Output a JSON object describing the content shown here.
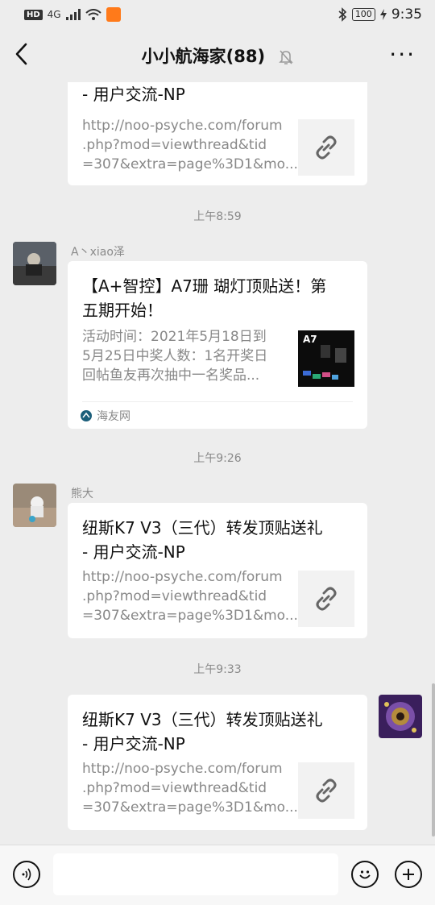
{
  "status_bar": {
    "left_badge": "HD",
    "network": "4G",
    "battery": "100",
    "time": "9:35"
  },
  "header": {
    "title": "小小航海家(88)",
    "more_label": "···"
  },
  "messages": [
    {
      "card_title": "- 用户交流-NP",
      "card_desc_1": "http://noo-psyche.com/forum",
      "card_desc_2": ".php?mod=viewthread&tid",
      "card_desc_3": "=307&extra=page%3D1&mo..."
    },
    {
      "time": "上午8:59",
      "sender": "A丶xiao泽",
      "card_title_1": "【A+智控】A7珊 瑚灯顶贴送！第",
      "card_title_2": "五期开始！",
      "card_desc_1": "活动时间：2021年5月18日到",
      "card_desc_2": "5月25日中奖人数：1名开奖日",
      "card_desc_3": "回帖鱼友再次抽中一名奖品...",
      "thumb_text": "A7",
      "source": "海友网"
    },
    {
      "time": "上午9:26",
      "sender": "熊大",
      "card_title_1": "纽斯K7 V3（三代）转发顶贴送礼",
      "card_title_2": "- 用户交流-NP",
      "card_desc_1": "http://noo-psyche.com/forum",
      "card_desc_2": ".php?mod=viewthread&tid",
      "card_desc_3": "=307&extra=page%3D1&mo..."
    },
    {
      "time": "上午9:33",
      "card_title_1": "纽斯K7 V3（三代）转发顶贴送礼",
      "card_title_2": "- 用户交流-NP",
      "card_desc_1": "http://noo-psyche.com/forum",
      "card_desc_2": ".php?mod=viewthread&tid",
      "card_desc_3": "=307&extra=page%3D1&mo..."
    }
  ],
  "icons": {
    "back": "back-icon",
    "mute": "bell-mute-icon",
    "voice": "voice-icon",
    "emoji": "emoji-icon",
    "add": "plus-icon",
    "link": "link-icon"
  },
  "colors": {
    "background": "#ededed",
    "card": "#ffffff",
    "muted_text": "#888888"
  }
}
